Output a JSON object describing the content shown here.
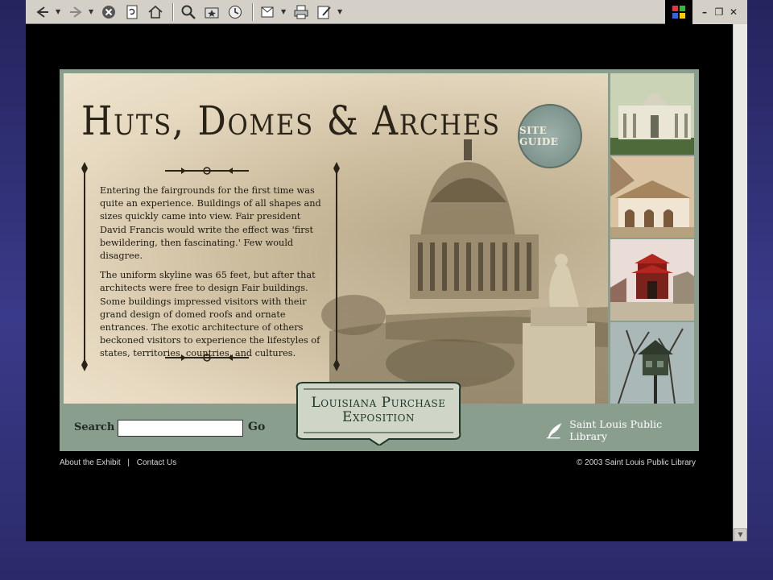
{
  "browser": {
    "toolbar_icons": [
      "back-icon",
      "forward-icon",
      "stop-icon",
      "refresh-icon",
      "home-icon",
      "search-icon",
      "favorites-icon",
      "history-icon",
      "mail-icon",
      "print-icon",
      "edit-icon"
    ],
    "window_controls": {
      "minimize": "–",
      "restore": "❐",
      "close": "✕"
    }
  },
  "site": {
    "title": "Huts, Domes & Arches",
    "site_guide": "SITE GUIDE",
    "body": [
      "Entering the fairgrounds for the first time was quite an experience. Buildings of all shapes and sizes quickly came into view. Fair president David Francis would write the effect was 'first bewildering, then fascinating.' Few would disagree.",
      "The uniform skyline was 65 feet, but after that architects were free to design Fair buildings. Some buildings impressed visitors with their grand design of domed roofs and ornate entrances. The exotic architecture of others beckoned visitors to experience the lifestyles of states, territories, countries, and cultures."
    ],
    "search_label": "Search",
    "search_value": "",
    "go_label": "Go",
    "banner_line1": "Louisiana Purchase",
    "banner_line2": "Exposition",
    "library_name": "Saint Louis Public Library"
  },
  "footer": {
    "about": "About the Exhibit",
    "separator": "|",
    "contact": "Contact Us",
    "copyright": "© 2003 Saint Louis Public Library"
  },
  "colors": {
    "frame": "#8a9e8e",
    "parchment": "#e6d9c0",
    "ink": "#2a2418"
  }
}
